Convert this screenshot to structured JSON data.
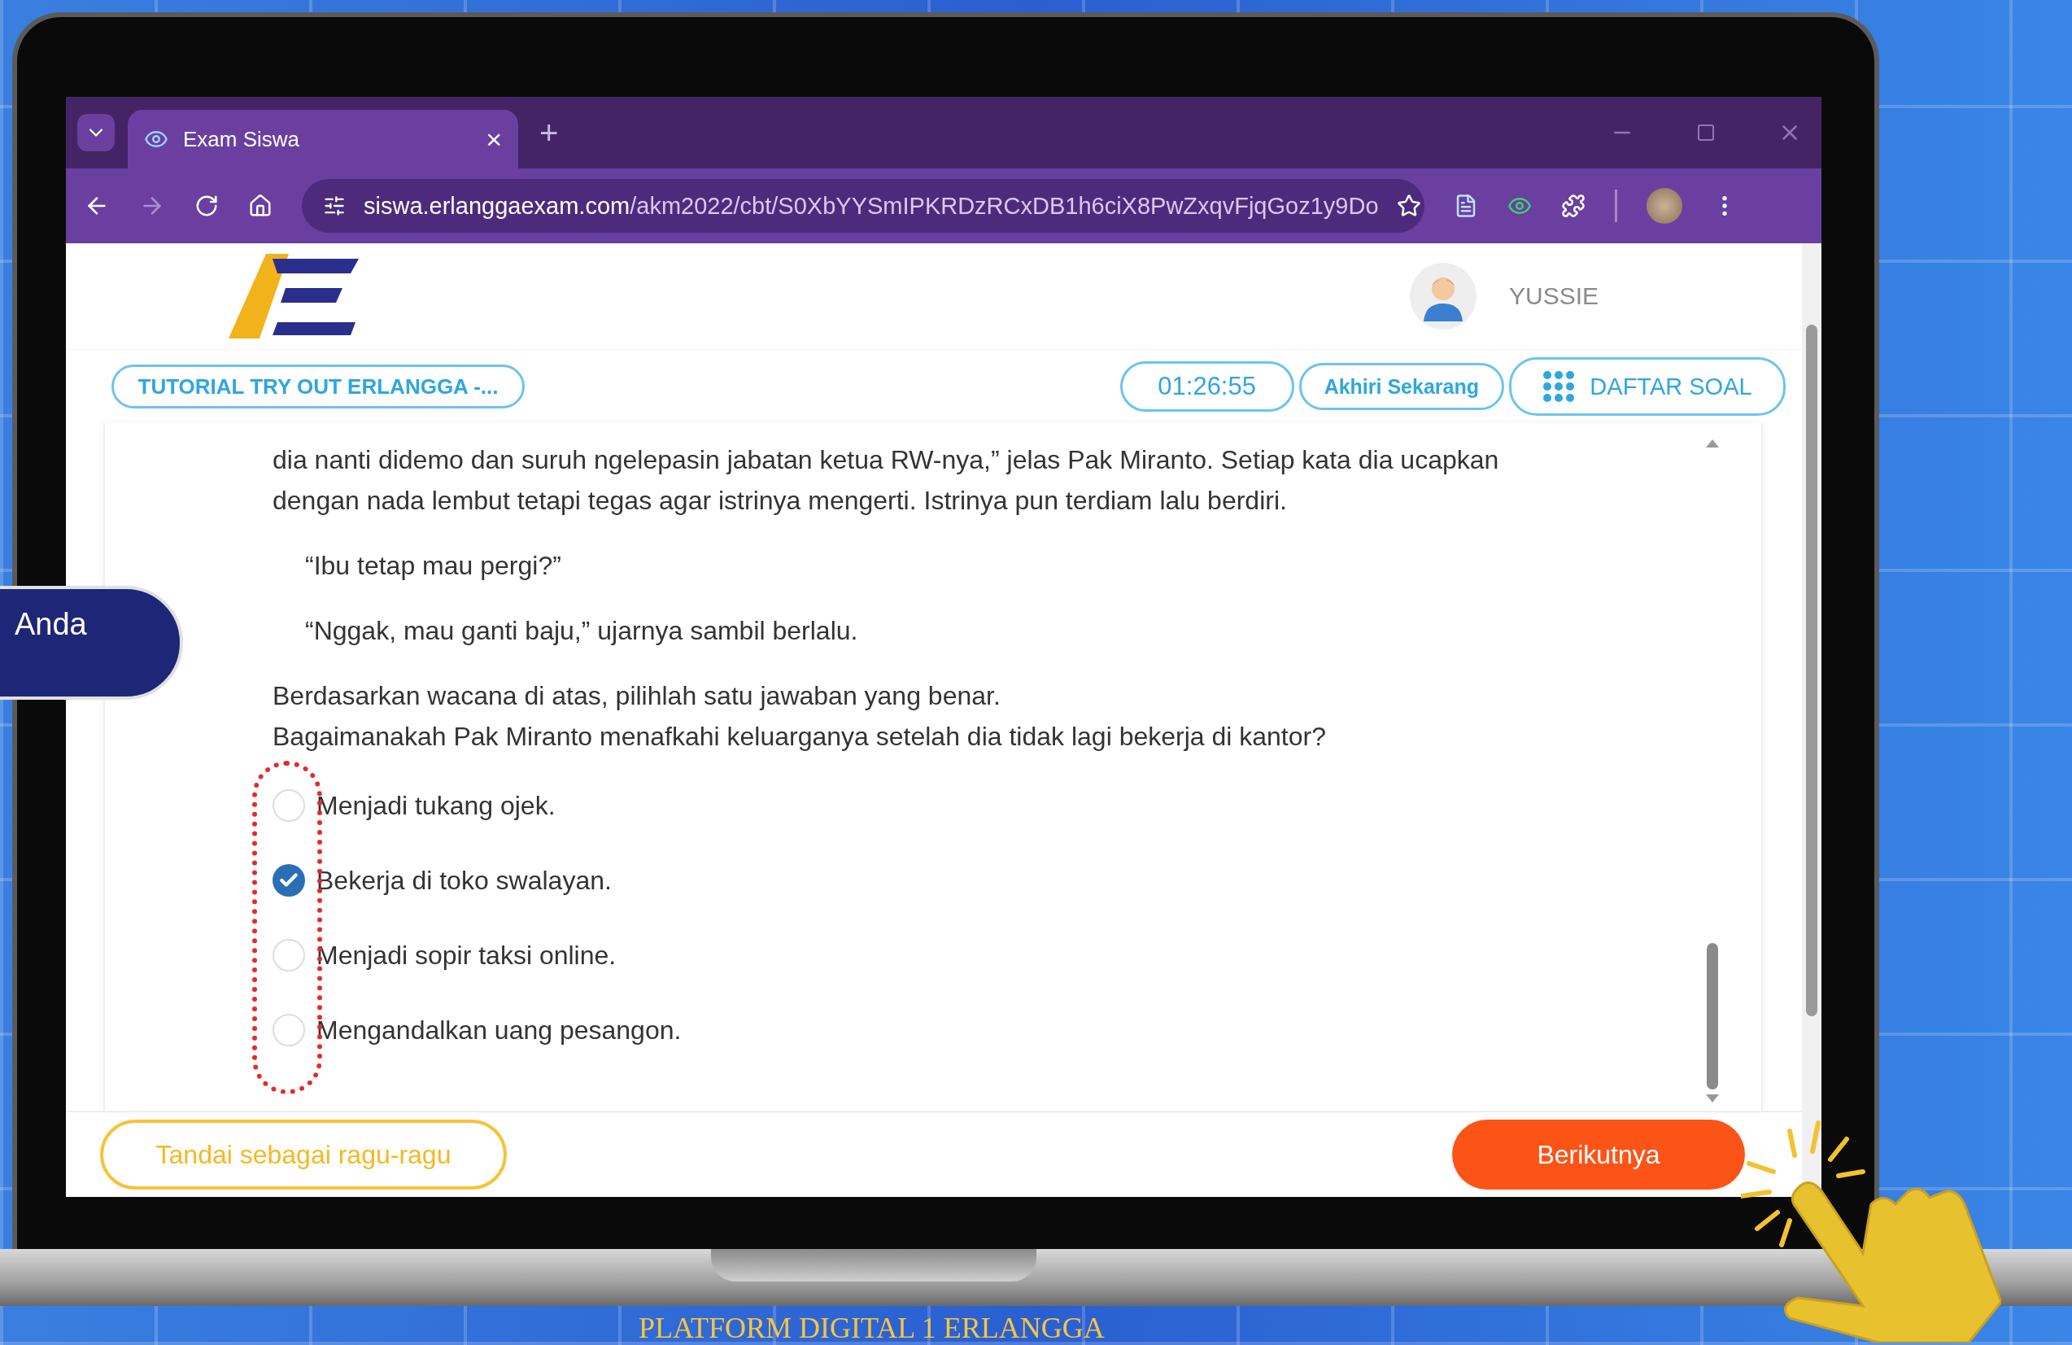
{
  "browser": {
    "tab_title": "Exam Siswa",
    "tab_close": "×",
    "new_tab": "+",
    "url_host": "siswa.erlanggaexam.com",
    "url_path": "/akm2022/cbt/S0XbYYSmIPKRDzRCxDB1h6ciX8PwZxqvFjqGoz1y9Do"
  },
  "header": {
    "user_name": "YUSSIE"
  },
  "toolbar": {
    "exam_title": "TUTORIAL TRY OUT ERLANGGA -...",
    "timer": "01:26:55",
    "end_button": "Akhiri Sekarang",
    "question_list_button": "DAFTAR SOAL"
  },
  "passage": [
    {
      "kind": "paragraph",
      "text": "dia nanti didemo dan suruh ngelepasin jabatan ketua RW-nya,” jelas Pak Miranto. Setiap kata dia ucapkan dengan nada lembut tetapi tegas agar istrinya mengerti. Istrinya pun terdiam lalu berdiri."
    },
    {
      "kind": "dialogue",
      "text": "“Ibu tetap mau pergi?”"
    },
    {
      "kind": "dialogue",
      "text": "“Nggak, mau ganti baju,” ujarnya sambil berlalu."
    }
  ],
  "question": [
    "Berdasarkan wacana di atas, pilihlah satu jawaban yang benar.",
    "Bagaimanakah Pak Miranto menafkahi keluarganya setelah dia tidak lagi bekerja di kantor?"
  ],
  "options": [
    {
      "label": "Menjadi tukang ojek.",
      "selected": false
    },
    {
      "label": "Bekerja di toko swalayan.",
      "selected": true
    },
    {
      "label": "Menjadi sopir taksi online.",
      "selected": false
    },
    {
      "label": "Mengandalkan uang pesangon.",
      "selected": false
    }
  ],
  "footer": {
    "flag_button": "Tandai sebagai ragu-ragu",
    "next_button": "Berikutnya"
  },
  "side_banner": {
    "text": "Anda"
  },
  "caption": "PLATFORM DIGITAL 1 ERLANGGA"
}
